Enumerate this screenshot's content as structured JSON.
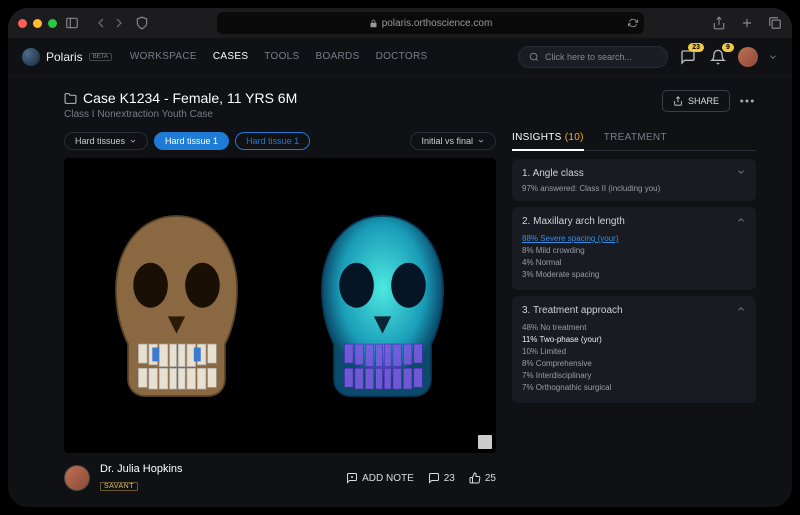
{
  "browser": {
    "url": "polaris.orthoscience.com"
  },
  "topbar": {
    "brand": "Polaris",
    "beta": "BETA",
    "nav": [
      "WORKSPACE",
      "CASES",
      "TOOLS",
      "BOARDS",
      "DOCTORS"
    ],
    "nav_active_index": 1,
    "search_placeholder": "Click here to search...",
    "badge_chat": "23",
    "badge_bell": "9"
  },
  "case": {
    "title": "Case K1234 - Female, 11 YRS 6M",
    "subtitle": "Class I Nonextraction Youth Case",
    "share": "SHARE"
  },
  "viewer": {
    "dropdown1": "Hard tissues",
    "pill_active": "Hard tissue 1",
    "pill_secondary": "Hard tissue 1",
    "dropdown2": "Initial vs final"
  },
  "doctor": {
    "name": "Dr. Julia Hopkins",
    "tag": "SAVANT"
  },
  "footer": {
    "add_note": "ADD NOTE",
    "comments": "23",
    "likes": "25"
  },
  "tabs": {
    "insights_label": "INSIGHTS",
    "insights_count": "(10)",
    "treatment_label": "TREATMENT"
  },
  "insights": [
    {
      "title": "1. Angle class",
      "expanded": false,
      "note": "97% answered: Class II (including you)"
    },
    {
      "title": "2. Maxillary arch length",
      "expanded": true,
      "items": [
        {
          "label": "88% Severe spacing (your)",
          "value": 88,
          "highlight": true
        },
        {
          "label": "8% Mild crowding",
          "value": 8
        },
        {
          "label": "4% Normal",
          "value": 4
        },
        {
          "label": "3% Moderate spacing",
          "value": 3
        }
      ]
    },
    {
      "title": "3. Treatment approach",
      "expanded": true,
      "items": [
        {
          "label": "48% No treatment",
          "value": 48
        },
        {
          "label": "11% Two-phase (your)",
          "value": 11,
          "bold": true
        },
        {
          "label": "10% Limited",
          "value": 10
        },
        {
          "label": "8% Comprehensive",
          "value": 8
        },
        {
          "label": "7% Interdisciplinary",
          "value": 7
        },
        {
          "label": "7% Orthognathic surgical",
          "value": 7
        }
      ]
    }
  ]
}
